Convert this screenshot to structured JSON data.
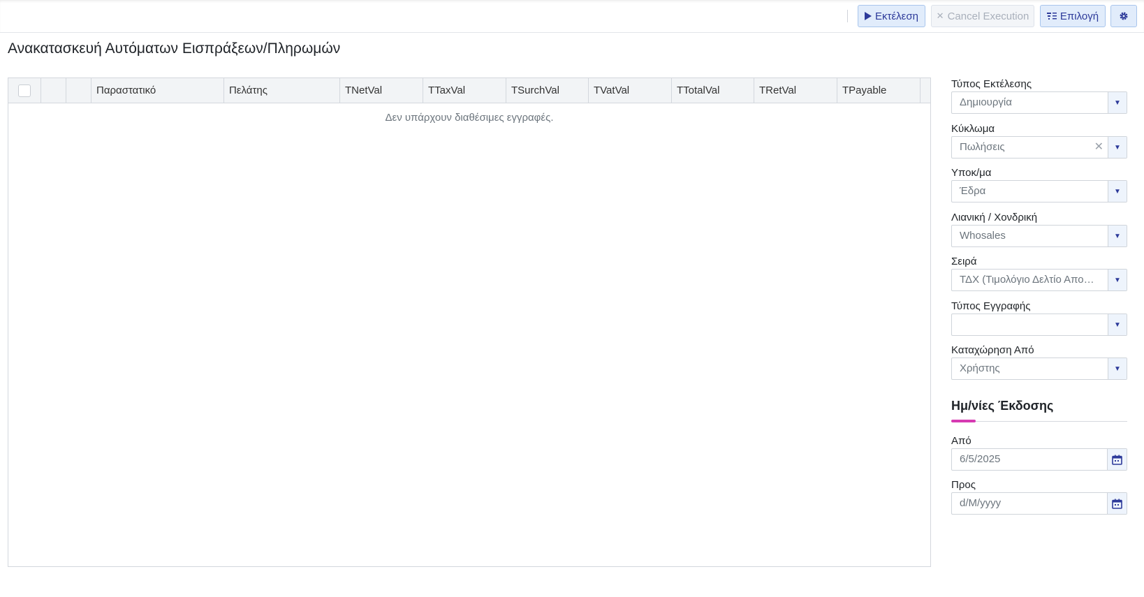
{
  "toolbar": {
    "execute_label": "Εκτέλεση",
    "cancel_label": "Cancel Execution",
    "select_label": "Επιλογή"
  },
  "page_title": "Ανακατασκευή Αυτόματων Εισπράξεων/Πληρωμών",
  "grid": {
    "columns": [
      "Παραστατικό",
      "Πελάτης",
      "TNetVal",
      "TTaxVal",
      "TSurchVal",
      "TVatVal",
      "TTotalVal",
      "TRetVal",
      "TPayable"
    ],
    "empty_message": "Δεν υπάρχουν διαθέσιμες εγγραφές."
  },
  "filters": {
    "execution_type": {
      "label": "Τύπος Εκτέλεσης",
      "value": "Δημιουργία"
    },
    "circuit": {
      "label": "Κύκλωμα",
      "value": "Πωλήσεις"
    },
    "branch": {
      "label": "Υποκ/μα",
      "value": "Έδρα"
    },
    "retail_wholesale": {
      "label": "Λιανική / Χονδρική",
      "value": "Whosales"
    },
    "series": {
      "label": "Σειρά",
      "value": "ΤΔΧ (Τιμολόγιο Δελτίο Αποστολής Χονδρικής)"
    },
    "entry_type": {
      "label": "Τύπος Εγγραφής",
      "value": ""
    },
    "registered_by": {
      "label": "Καταχώρηση Από",
      "value": "Χρήστης"
    }
  },
  "issue_dates": {
    "title": "Ημ/νίες Έκδοσης",
    "from_label": "Από",
    "from_value": "6/5/2025",
    "to_label": "Προς",
    "to_placeholder": "d/M/yyyy"
  },
  "colors": {
    "accent": "#2d3a9a",
    "button_bg": "#e1ecfb",
    "section_accent": "#d63ab2"
  },
  "icons": {
    "execute": "play-icon",
    "cancel": "close-icon",
    "select": "filter-list-icon",
    "settings": "gear-icon",
    "dropdown": "caret-down-icon",
    "calendar": "calendar-icon"
  }
}
